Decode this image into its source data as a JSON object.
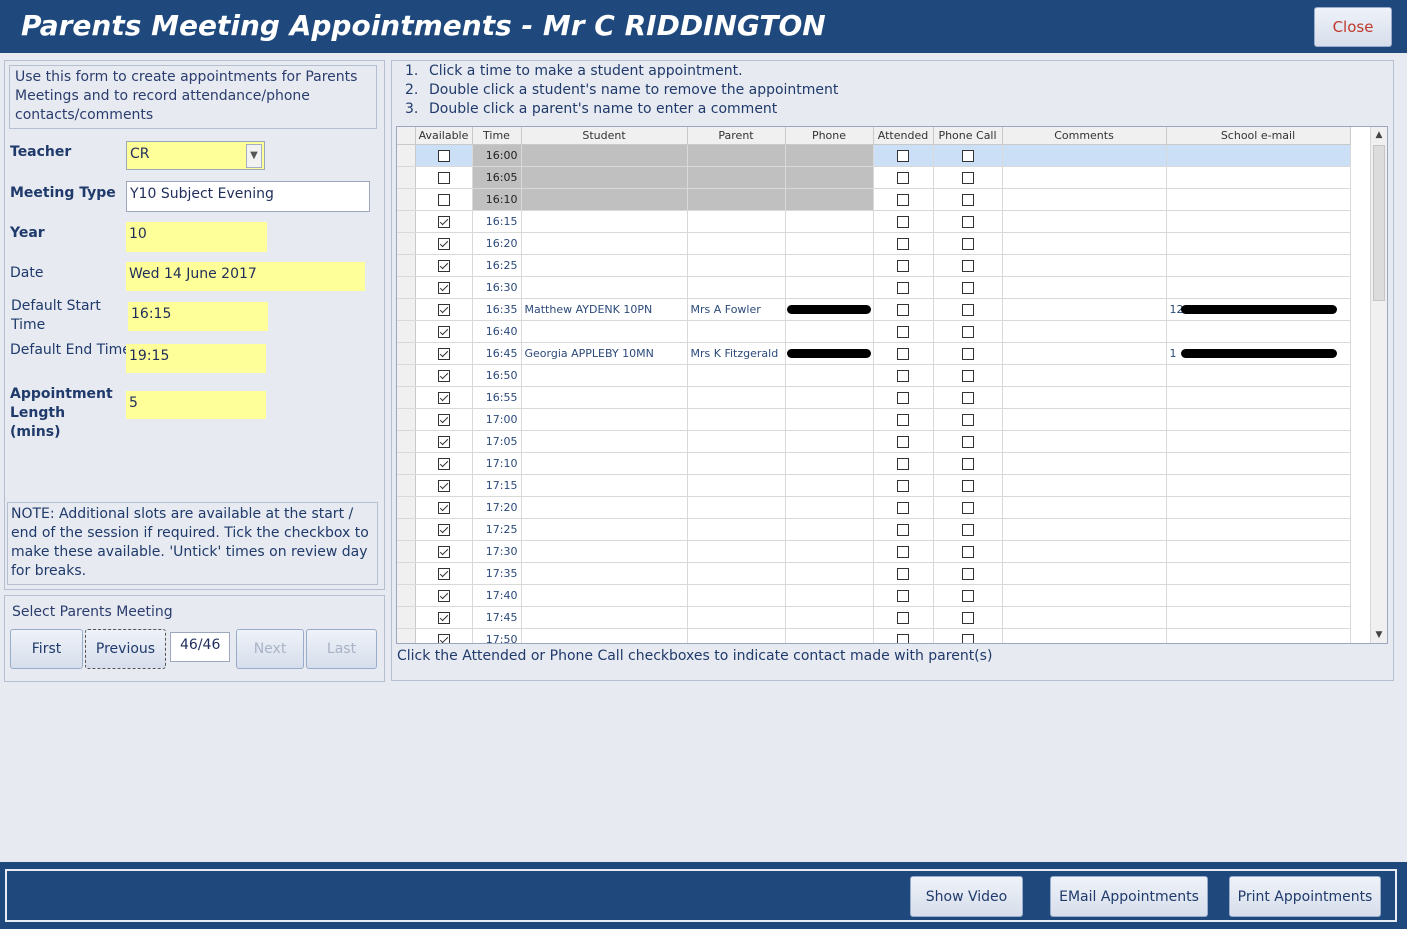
{
  "window": {
    "title": "Parents Meeting Appointments - Mr C RIDDINGTON",
    "close_label": "Close"
  },
  "form": {
    "intro": "Use this form to create appointments for Parents Meetings and to record attendance/phone contacts/comments",
    "teacher_label": "Teacher",
    "teacher_value": "CR",
    "meeting_type_label": "Meeting Type",
    "meeting_type_value": "Y10 Subject Evening",
    "year_label": "Year",
    "year_value": "10",
    "date_label": "Date",
    "date_value": "Wed 14 June 2017",
    "default_start_label": "Default Start Time",
    "default_start_value": "16:15",
    "default_end_label": "Default End Time",
    "default_end_value": "19:15",
    "appt_length_label": "Appointment Length (mins)",
    "appt_length_value": "5",
    "note": "NOTE: Additional slots are available at the start / end of the session if required. Tick the checkbox to make these available.  'Untick' times on review day for breaks."
  },
  "navigation": {
    "label": "Select Parents Meeting",
    "first": "First",
    "previous": "Previous",
    "record": "46/46",
    "next": "Next",
    "last": "Last"
  },
  "instructions": [
    {
      "num": "1.",
      "text": "Click a time to make a student appointment."
    },
    {
      "num": "2.",
      "text": "Double click a student's name to remove the appointment"
    },
    {
      "num": "3.",
      "text": "Double click a parent's name to enter a comment"
    }
  ],
  "grid": {
    "columns": [
      "Available",
      "Time",
      "Student",
      "Parent",
      "Phone",
      "Attended",
      "Phone Call",
      "Comments",
      "School e-mail"
    ],
    "rows": [
      {
        "available": false,
        "time": "16:00",
        "student": "",
        "parent": "",
        "phone": "",
        "attended": false,
        "phone_call": false,
        "comments": "",
        "email": "",
        "grey": true,
        "current": true
      },
      {
        "available": false,
        "time": "16:05",
        "student": "",
        "parent": "",
        "phone": "",
        "attended": false,
        "phone_call": false,
        "comments": "",
        "email": "",
        "grey": true
      },
      {
        "available": false,
        "time": "16:10",
        "student": "",
        "parent": "",
        "phone": "",
        "attended": false,
        "phone_call": false,
        "comments": "",
        "email": "",
        "grey": true
      },
      {
        "available": true,
        "time": "16:15",
        "student": "",
        "parent": "",
        "phone": "",
        "attended": false,
        "phone_call": false,
        "comments": "",
        "email": ""
      },
      {
        "available": true,
        "time": "16:20",
        "student": "",
        "parent": "",
        "phone": "",
        "attended": false,
        "phone_call": false,
        "comments": "",
        "email": ""
      },
      {
        "available": true,
        "time": "16:25",
        "student": "",
        "parent": "",
        "phone": "",
        "attended": false,
        "phone_call": false,
        "comments": "",
        "email": ""
      },
      {
        "available": true,
        "time": "16:30",
        "student": "",
        "parent": "",
        "phone": "",
        "attended": false,
        "phone_call": false,
        "comments": "",
        "email": ""
      },
      {
        "available": true,
        "time": "16:35",
        "student": "Matthew AYDENK 10PN",
        "parent": "Mrs A Fowler",
        "phone": "",
        "attended": false,
        "phone_call": false,
        "comments": "",
        "email": "12",
        "redacted": true
      },
      {
        "available": true,
        "time": "16:40",
        "student": "",
        "parent": "",
        "phone": "",
        "attended": false,
        "phone_call": false,
        "comments": "",
        "email": ""
      },
      {
        "available": true,
        "time": "16:45",
        "student": "Georgia APPLEBY 10MN",
        "parent": "Mrs K Fitzgerald",
        "phone": "",
        "attended": false,
        "phone_call": false,
        "comments": "",
        "email": "1",
        "redacted": true
      },
      {
        "available": true,
        "time": "16:50",
        "student": "",
        "parent": "",
        "phone": "",
        "attended": false,
        "phone_call": false,
        "comments": "",
        "email": ""
      },
      {
        "available": true,
        "time": "16:55",
        "student": "",
        "parent": "",
        "phone": "",
        "attended": false,
        "phone_call": false,
        "comments": "",
        "email": ""
      },
      {
        "available": true,
        "time": "17:00",
        "student": "",
        "parent": "",
        "phone": "",
        "attended": false,
        "phone_call": false,
        "comments": "",
        "email": ""
      },
      {
        "available": true,
        "time": "17:05",
        "student": "",
        "parent": "",
        "phone": "",
        "attended": false,
        "phone_call": false,
        "comments": "",
        "email": ""
      },
      {
        "available": true,
        "time": "17:10",
        "student": "",
        "parent": "",
        "phone": "",
        "attended": false,
        "phone_call": false,
        "comments": "",
        "email": ""
      },
      {
        "available": true,
        "time": "17:15",
        "student": "",
        "parent": "",
        "phone": "",
        "attended": false,
        "phone_call": false,
        "comments": "",
        "email": ""
      },
      {
        "available": true,
        "time": "17:20",
        "student": "",
        "parent": "",
        "phone": "",
        "attended": false,
        "phone_call": false,
        "comments": "",
        "email": ""
      },
      {
        "available": true,
        "time": "17:25",
        "student": "",
        "parent": "",
        "phone": "",
        "attended": false,
        "phone_call": false,
        "comments": "",
        "email": ""
      },
      {
        "available": true,
        "time": "17:30",
        "student": "",
        "parent": "",
        "phone": "",
        "attended": false,
        "phone_call": false,
        "comments": "",
        "email": ""
      },
      {
        "available": true,
        "time": "17:35",
        "student": "",
        "parent": "",
        "phone": "",
        "attended": false,
        "phone_call": false,
        "comments": "",
        "email": ""
      },
      {
        "available": true,
        "time": "17:40",
        "student": "",
        "parent": "",
        "phone": "",
        "attended": false,
        "phone_call": false,
        "comments": "",
        "email": ""
      },
      {
        "available": true,
        "time": "17:45",
        "student": "",
        "parent": "",
        "phone": "",
        "attended": false,
        "phone_call": false,
        "comments": "",
        "email": ""
      },
      {
        "available": true,
        "time": "17:50",
        "student": "",
        "parent": "",
        "phone": "",
        "attended": false,
        "phone_call": false,
        "comments": "",
        "email": ""
      }
    ]
  },
  "footer_note": "Click the Attended or Phone Call checkboxes to indicate contact made with parent(s)",
  "bottom_buttons": {
    "show_video": "Show Video",
    "email": "EMail Appointments",
    "print": "Print Appointments"
  },
  "icons": {
    "combo": "chevron-down-icon",
    "scroll_up": "scroll-up-icon",
    "scroll_down": "scroll-down-icon"
  },
  "colors": {
    "brand": "#1f497d",
    "field_highlight": "#ffff99",
    "close_text": "#c0392b"
  }
}
